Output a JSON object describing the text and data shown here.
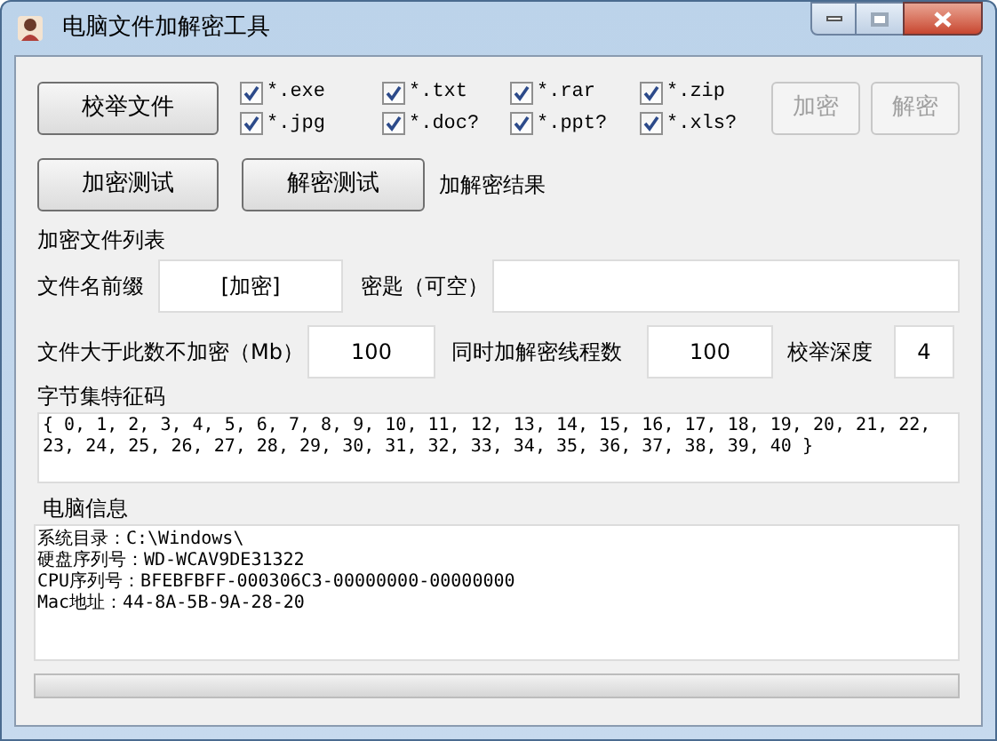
{
  "window": {
    "title": "电脑文件加解密工具"
  },
  "enumerate_button": {
    "label": "校举文件",
    "disabled": false
  },
  "file_types": [
    {
      "label": "*.exe",
      "checked": true
    },
    {
      "label": "*.txt",
      "checked": true
    },
    {
      "label": "*.rar",
      "checked": true
    },
    {
      "label": "*.zip",
      "checked": true
    },
    {
      "label": "*.jpg",
      "checked": true
    },
    {
      "label": "*.doc?",
      "checked": true
    },
    {
      "label": "*.ppt?",
      "checked": true
    },
    {
      "label": "*.xls?",
      "checked": true
    }
  ],
  "action_buttons": [
    {
      "label": "加密",
      "disabled": true
    },
    {
      "label": "解密",
      "disabled": true
    }
  ],
  "test_buttons": [
    {
      "label": "加密测试",
      "disabled": false
    },
    {
      "label": "解密测试",
      "disabled": false
    }
  ],
  "result_label": "加解密结果",
  "file_list_label": "加密文件列表",
  "prefix": {
    "label": "文件名前缀",
    "value": "[加密]"
  },
  "key": {
    "label": "密匙（可空）"
  },
  "size_limit": {
    "label": "文件大于此数不加密（Mb）",
    "value": "100"
  },
  "threads": {
    "label": "同时加解密线程数",
    "value": "100"
  },
  "depth": {
    "label": "校举深度",
    "value": "4"
  },
  "signature": {
    "label": "字节集特征码",
    "value": "{ 0, 1, 2, 3, 4, 5, 6, 7, 8, 9, 10, 11, 12, 13, 14, 15, 16, 17, 18, 19, 20, 21, 22, 23, 24, 25, 26, 27, 28, 29, 30, 31, 32, 33, 34, 35, 36, 37, 38, 39, 40 }"
  },
  "info": {
    "label": "电脑信息",
    "lines": [
      "系统目录：C:\\Windows\\",
      "硬盘序列号：WD-WCAV9DE31322",
      "CPU序列号：BFEBFBFF-000306C3-00000000-00000000",
      "Mac地址：44-8A-5B-9A-28-20"
    ]
  },
  "progress": {
    "level": 0
  }
}
